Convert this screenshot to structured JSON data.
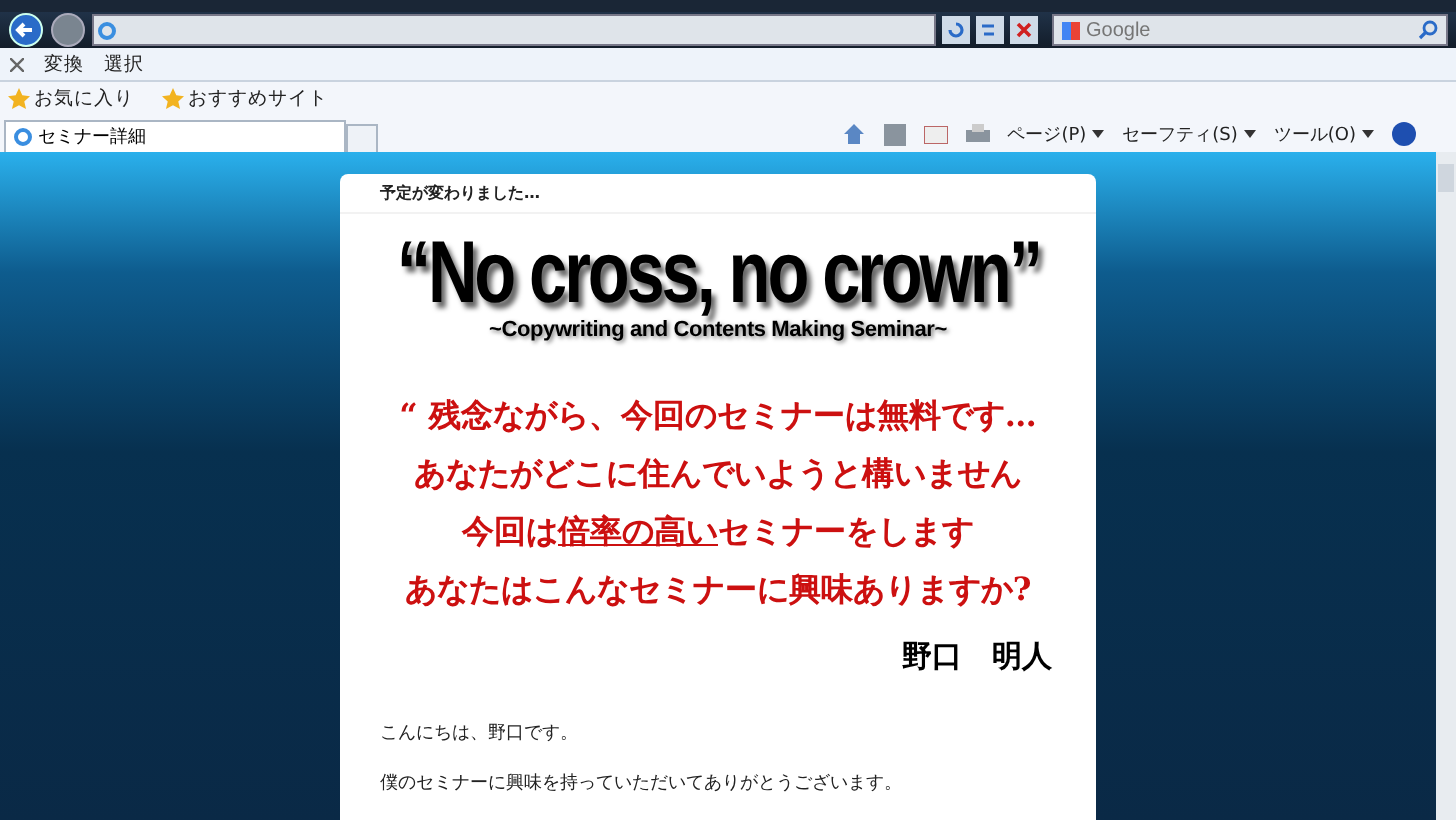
{
  "search": {
    "placeholder": "Google"
  },
  "command_bar": {
    "items": [
      "変換",
      "選択"
    ]
  },
  "favorites_bar": {
    "items": [
      "お気に入り",
      "おすすめサイト"
    ]
  },
  "tabs": [
    {
      "label": "セミナー詳細",
      "selected": true
    }
  ],
  "page_toolbar": {
    "menus": [
      "ページ(P)",
      "セーフティ(S)",
      "ツール(O)"
    ]
  },
  "page": {
    "notice": "予定が変わりました…",
    "headline": "“No cross, no crown”",
    "subtitle": "~Copywriting and Contents Making Seminar~",
    "red_lines": [
      {
        "segments": [
          {
            "text": "“ 残念ながら、今回のセミナーは無料です…",
            "underlined": false
          }
        ]
      },
      {
        "segments": [
          {
            "text": "あなたがどこに住んでいようと構いません",
            "underlined": false
          }
        ]
      },
      {
        "segments": [
          {
            "text": "今回は",
            "underlined": false
          },
          {
            "text": "倍率の高い",
            "underlined": true
          },
          {
            "text": "セミナーをします",
            "underlined": false
          }
        ]
      },
      {
        "segments": [
          {
            "text": "あなたはこんなセミナーに興味ありますか?",
            "underlined": false
          }
        ]
      }
    ],
    "signature": "野口　明人",
    "paragraphs": [
      "こんにちは、野口です。",
      "僕のセミナーに興味を持っていただいてありがとうございます。"
    ]
  }
}
